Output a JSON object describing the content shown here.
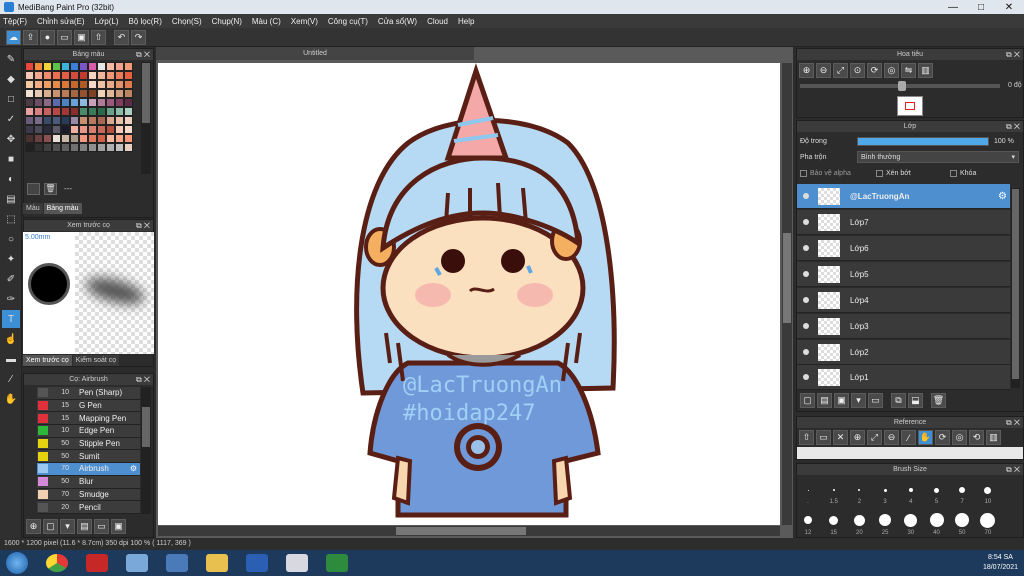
{
  "app": {
    "title": "MediBang Paint Pro (32bit)",
    "window_controls": [
      "—",
      "□",
      "✕"
    ]
  },
  "menu": [
    "Tệp(F)",
    "Chỉnh sửa(E)",
    "Lớp(L)",
    "Bộ lọc(R)",
    "Chọn(S)",
    "Chụp(N)",
    "Màu (C)",
    "Xem(V)",
    "Công cụ(T)",
    "Cửa sổ(W)",
    "Cloud",
    "Help"
  ],
  "toolbar": {
    "icons": [
      "cloud-icon",
      "export-icon",
      "comment-icon",
      "open-icon",
      "save-icon",
      "upload-icon",
      "undo-icon",
      "redo-icon"
    ]
  },
  "color_panel": {
    "title": "Bảng màu",
    "tabs": [
      "Màu",
      "Bảng màu"
    ],
    "dots": "---",
    "swatches": [
      "#e8473e",
      "#f28b3a",
      "#f6d23a",
      "#5cc24a",
      "#3cb3d9",
      "#3c7fd6",
      "#7b56c8",
      "#d65ea8",
      "#e6e6e6",
      "#f5b9a6",
      "#f2a28c",
      "#f19a7a",
      "#f5c7b6",
      "#f2a88f",
      "#f08a6c",
      "#ee6e52",
      "#e45d46",
      "#d64c3c",
      "#c23b30",
      "#f7d3c2",
      "#f3b49c",
      "#ef9678",
      "#eb7a5a",
      "#e6603f",
      "#f6c9a5",
      "#f2ad82",
      "#eea063",
      "#e88a48",
      "#d9783a",
      "#c6682e",
      "#b05a26",
      "#f4d9c8",
      "#efc2a8",
      "#eaa988",
      "#e4926a",
      "#dd7a4e",
      "#f2e1d3",
      "#e6c8b1",
      "#d8ad90",
      "#c99372",
      "#b97b58",
      "#a86542",
      "#945231",
      "#7e4124",
      "#f0d2b8",
      "#e0b798",
      "#cf9c7a",
      "#bd845f",
      "#4a3b45",
      "#6a4f66",
      "#8a6a84",
      "#5a6bb0",
      "#4c82c0",
      "#6aa0d8",
      "#8fb8e0",
      "#c8a0b8",
      "#b07a98",
      "#9a5a7c",
      "#7f3e60",
      "#5e2a48",
      "#e8a0a0",
      "#d88080",
      "#c86060",
      "#b84848",
      "#a03838",
      "#882c2c",
      "#4a8a6a",
      "#3a7a5a",
      "#2a6a4a",
      "#6aa08a",
      "#8abaa8",
      "#aad0c2",
      "#6a5a7a",
      "#7a6a8a",
      "#3a4a6a",
      "#4a5a7a",
      "#2a3a5a",
      "#9a8aaa",
      "#c89070",
      "#b87860",
      "#a86850",
      "#d8a890",
      "#e8c0a8",
      "#f0d0c0",
      "#3a3a4a",
      "#4a4a5a",
      "#2a2a3a",
      "#5a5a6a",
      "#1a1a2a",
      "#f0b0a0",
      "#e89888",
      "#d88070",
      "#c86858",
      "#b85040",
      "#f8c8b8",
      "#f8d8c8",
      "#4a3030",
      "#6a4040",
      "#8a5050",
      "#e8e0d8",
      "#c8b8a8",
      "#a89888",
      "#f09880",
      "#e07860",
      "#d06048",
      "#f8b8a0",
      "#f8a888",
      "#f89878",
      "#202020",
      "#303030",
      "#404040",
      "#505050",
      "#606060",
      "#707070",
      "#808080",
      "#909090",
      "#a0a0a0",
      "#b0b0b0",
      "#c0c0c0",
      "#e8d0c0"
    ]
  },
  "preview_panel": {
    "title": "Xem trước cọ",
    "size_label": "5.00mm",
    "tabs": [
      "Xem trước cọ",
      "Kiểm soát cọ"
    ]
  },
  "brush_panel": {
    "title": "Cọ: Airbrush",
    "brushes": [
      {
        "size": "10",
        "name": "Pen (Sharp)",
        "color": "#555555"
      },
      {
        "size": "15",
        "name": "G Pen",
        "color": "#e0303a"
      },
      {
        "size": "15",
        "name": "Mapping Pen",
        "color": "#e0303a"
      },
      {
        "size": "10",
        "name": "Edge Pen",
        "color": "#2eb83a"
      },
      {
        "size": "50",
        "name": "Stipple Pen",
        "color": "#e6d20e"
      },
      {
        "size": "50",
        "name": "Sumit",
        "color": "#e6d20e"
      },
      {
        "size": "70",
        "name": "Airbrush",
        "color": "#9ac8f0",
        "selected": true
      },
      {
        "size": "50",
        "name": "Blur",
        "color": "#d48ad8"
      },
      {
        "size": "70",
        "name": "Smudge",
        "color": "#f0d0b0"
      },
      {
        "size": "20",
        "name": "Pencil",
        "color": "#555555"
      }
    ]
  },
  "canvas": {
    "tab_title": "Untitled",
    "watermark1": "@LacTruongAn",
    "watermark2": "#hoidap247"
  },
  "navigator": {
    "title": "Hoa tiêu",
    "angle": "0 độ"
  },
  "layer_panel": {
    "title": "Lớp",
    "opacity_label": "Độ trong",
    "opacity_value": "100 %",
    "opacity": 1.0,
    "blend_label": "Pha trộn",
    "blend_value": "Bình thường",
    "protect_alpha": "Bảo vệ alpha",
    "clipping": "Xén bớt",
    "lock": "Khóa",
    "layers": [
      {
        "name": "@LacTruongAn",
        "selected": true
      },
      {
        "name": "Lớp7"
      },
      {
        "name": "Lớp6"
      },
      {
        "name": "Lớp5"
      },
      {
        "name": "Lớp4"
      },
      {
        "name": "Lớp3"
      },
      {
        "name": "Lớp2"
      },
      {
        "name": "Lớp1"
      }
    ]
  },
  "reference_panel": {
    "title": "Reference"
  },
  "brush_size_panel": {
    "title": "Brush Size",
    "row1": [
      ".",
      "1.5",
      "2",
      "3",
      "4",
      "5",
      "7",
      "10"
    ],
    "row2": [
      "12",
      "15",
      "20",
      "25",
      "30",
      "40",
      "50",
      "70"
    ]
  },
  "status": {
    "text": "1600 * 1200 pixel  (11.6 * 8.7cm)  350 dpi  100 %  ( 1117, 369 )"
  },
  "taskbar": {
    "time": "8:54 SA",
    "date": "18/07/2021"
  }
}
